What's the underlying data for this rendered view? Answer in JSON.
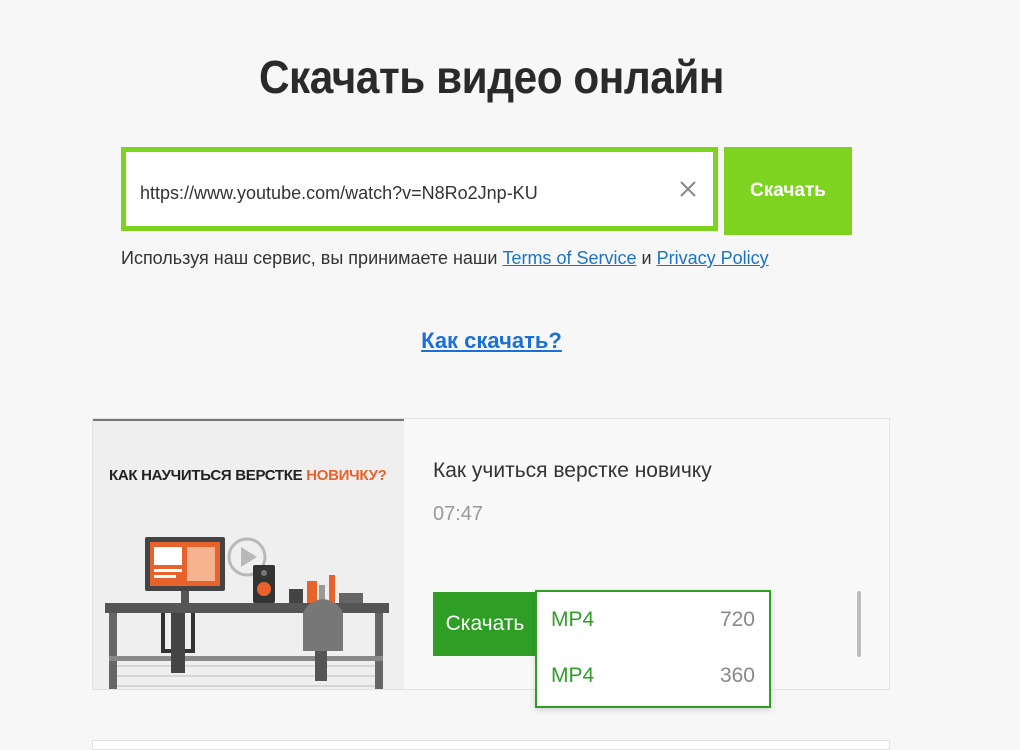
{
  "header": {
    "title": "Скачать видео онлайн"
  },
  "search": {
    "url": "https://www.youtube.com/watch?v=N8Ro2Jnp-KU",
    "button_label": "Скачать"
  },
  "terms": {
    "text": "Используя наш сервис, вы принимаете наши",
    "tos_link": "Terms of Service",
    "and": "и",
    "privacy_link": "Privacy Policy"
  },
  "howto": {
    "link": "Как скачать?"
  },
  "result": {
    "thumbnail": {
      "title_part1": "КАК НАУЧИТЬСЯ ВЕРСТКЕ ",
      "title_highlight": "НОВИЧКУ?",
      "accent": "#e8632c"
    },
    "title": "Как учиться верстке новичку",
    "duration": "07:47",
    "download_label": "Скачать",
    "options": [
      {
        "format": "MP4",
        "quality": "720"
      },
      {
        "format": "MP4",
        "quality": "360"
      }
    ]
  },
  "colors": {
    "accent": "#7ed321",
    "download": "#2e9e24",
    "link": "#1a73c9"
  }
}
